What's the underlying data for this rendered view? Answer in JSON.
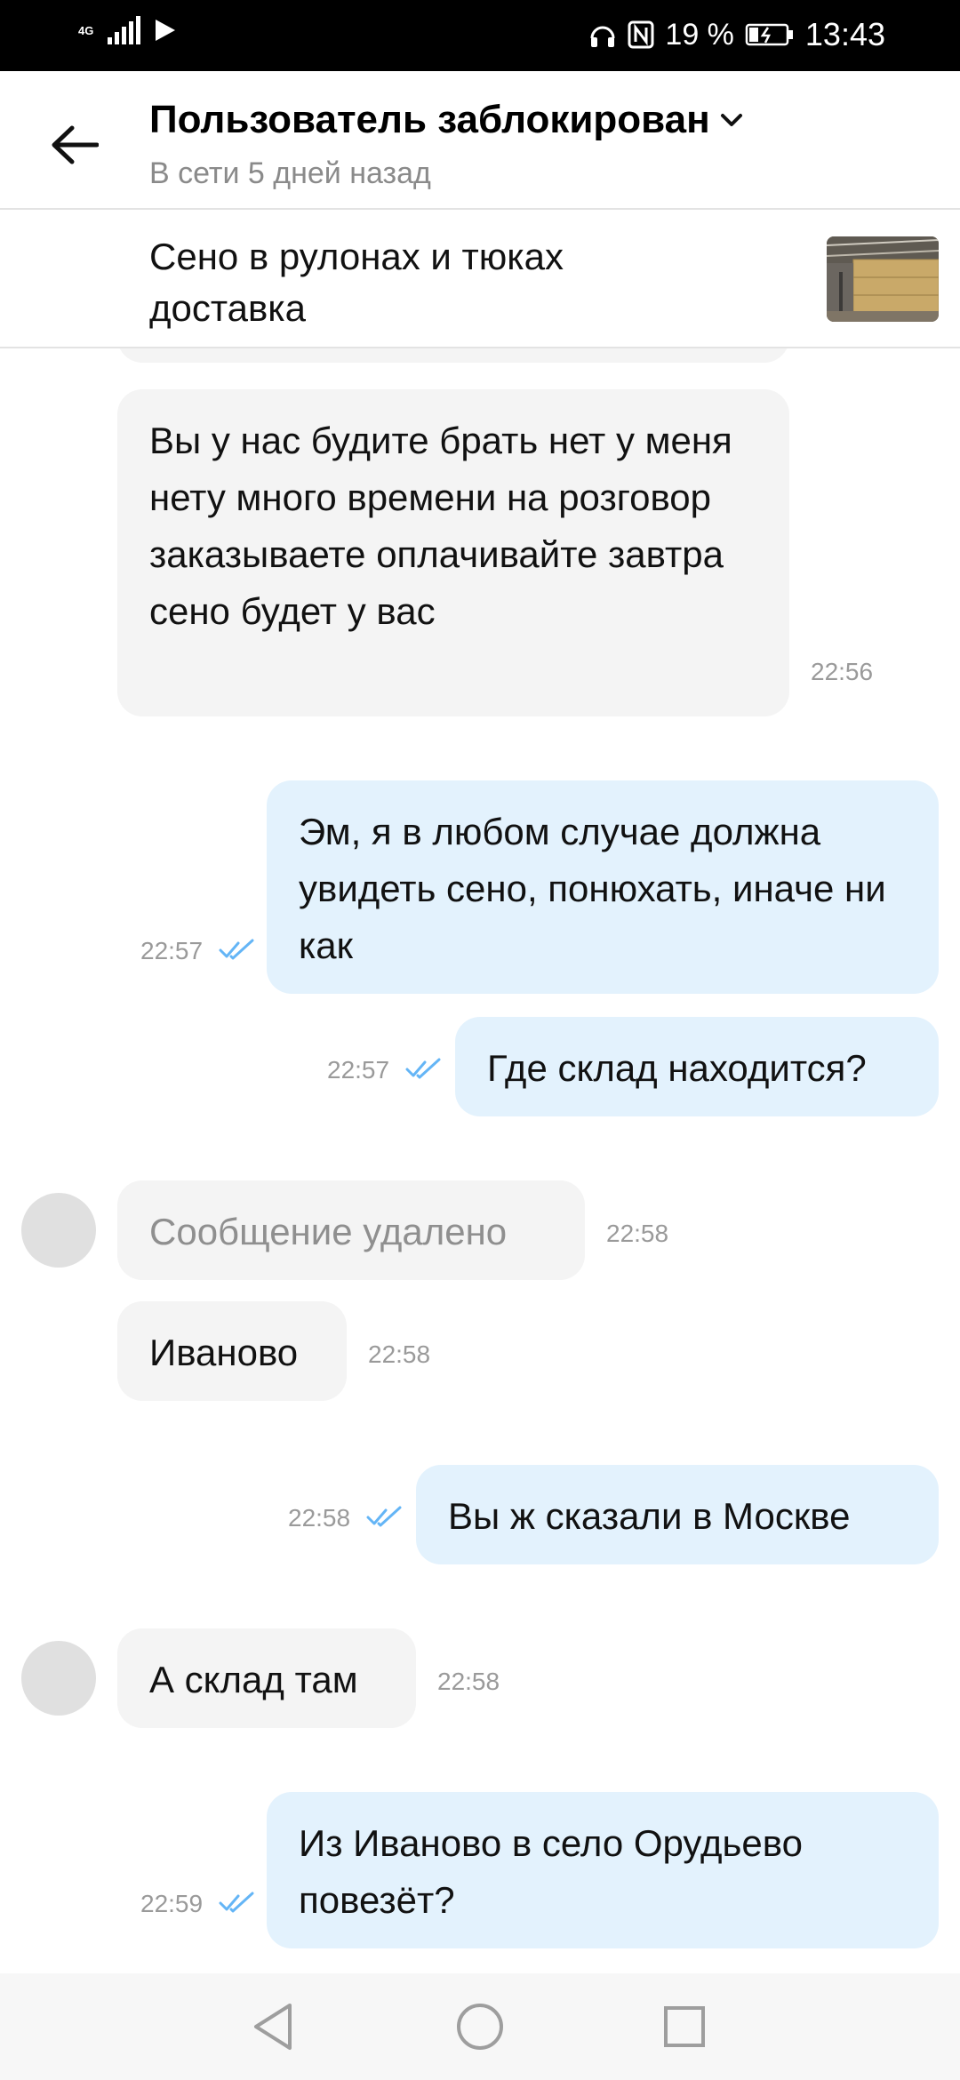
{
  "status_bar": {
    "network": "4G",
    "battery": "19 %",
    "time": "13:43"
  },
  "header": {
    "title": "Пользователь заблокирован",
    "subtitle": "В сети 5 дней назад"
  },
  "listing": {
    "title": "Сено в рулонах и тюках доставка"
  },
  "messages": [
    {
      "direction": "in",
      "text": "Вы у нас будите брать нет у меня нету много времени на розговор заказываете оплачивайте завтра сено будет у вас",
      "time": "22:56"
    },
    {
      "direction": "out",
      "text": "Эм, я в любом случае должна увидеть сено, понюхать, иначе ни как",
      "time": "22:57"
    },
    {
      "direction": "out",
      "text": "Где склад находится?",
      "time": "22:57"
    },
    {
      "direction": "in",
      "text": "Сообщение удалено",
      "time": "22:58",
      "deleted": true
    },
    {
      "direction": "in",
      "text": "Иваново",
      "time": "22:58"
    },
    {
      "direction": "out",
      "text": "Вы ж сказали в Москве",
      "time": "22:58"
    },
    {
      "direction": "in",
      "text": "А склад там",
      "time": "22:58"
    },
    {
      "direction": "out",
      "text": "Из Иваново в село Орудьево повезёт?",
      "time": "22:59"
    }
  ],
  "colors": {
    "incoming_bubble": "#f4f4f4",
    "outgoing_bubble": "#e3f2fd",
    "read_ticks": "#64b5f6"
  },
  "icons": {
    "back": "arrow-left-icon",
    "dropdown": "chevron-down-icon",
    "read": "double-check-icon",
    "nav_back": "triangle-back-icon",
    "nav_home": "circle-home-icon",
    "nav_recent": "square-recent-icon"
  }
}
